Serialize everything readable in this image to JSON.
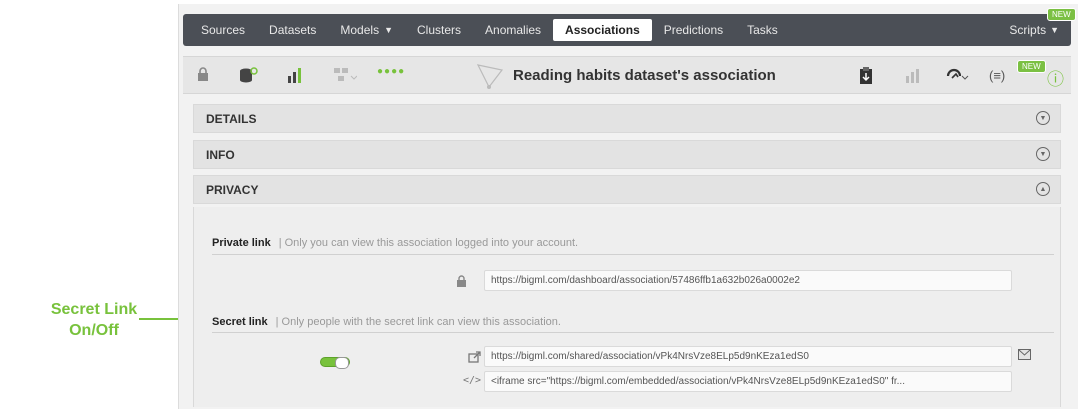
{
  "nav": {
    "items": [
      "Sources",
      "Datasets",
      "Models",
      "Clusters",
      "Anomalies",
      "Associations",
      "Predictions",
      "Tasks"
    ],
    "models_caret": "▼",
    "scripts_label": "Scripts",
    "scripts_caret": "▼",
    "new_badge": "NEW"
  },
  "toolbar": {
    "title": "Reading habits dataset's association",
    "dots": "●●●●",
    "new_badge": "NEW",
    "info_icon": "ⓘ"
  },
  "sections": {
    "details": "DETAILS",
    "info": "INFO",
    "privacy": "PRIVACY"
  },
  "privacy": {
    "private_label": "Private link",
    "private_desc": "| Only you can view this association logged into your account.",
    "private_url": "https://bigml.com/dashboard/association/57486ffb1a632b026a0002e2",
    "secret_label": "Secret link",
    "secret_desc": "| Only people with the secret link can view this association.",
    "secret_url": "https://bigml.com/shared/association/vPk4NrsVze8ELp5d9nKEza1edS0",
    "embed_code": "<iframe src=\"https://bigml.com/embedded/association/vPk4NrsVze8ELp5d9nKEza1edS0\" fr...",
    "secret_enabled": true
  },
  "annotation": {
    "line1": "Secret Link",
    "line2": "On/Off"
  },
  "colors": {
    "accent_green": "#78c23c",
    "nav_bg": "#4b4f56"
  }
}
